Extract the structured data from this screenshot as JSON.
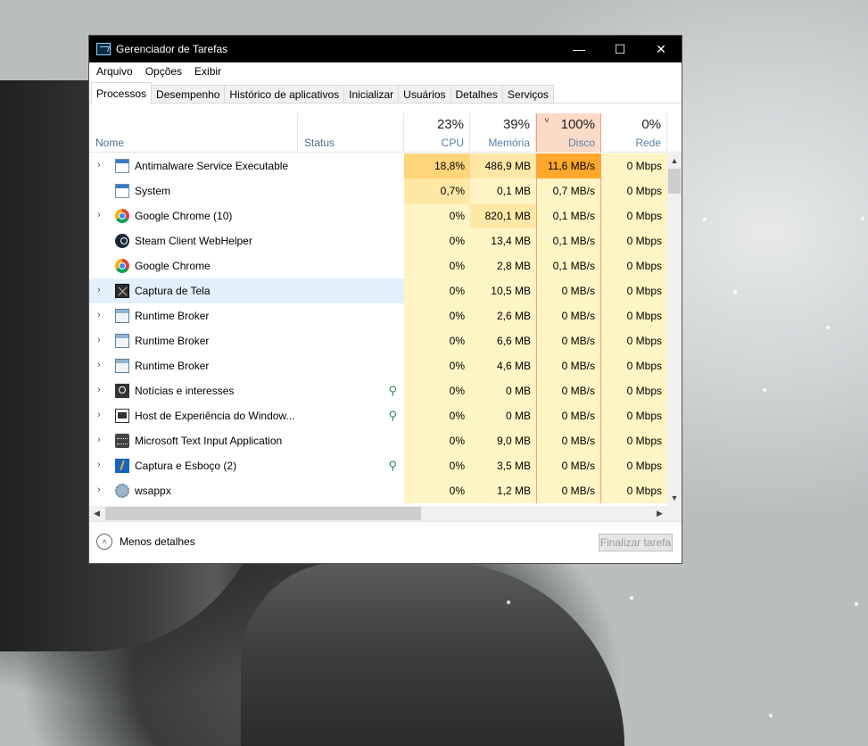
{
  "window": {
    "title": "Gerenciador de Tarefas",
    "controls": {
      "minimize": "—",
      "maximize": "☐",
      "close": "✕"
    }
  },
  "menu": [
    "Arquivo",
    "Opções",
    "Exibir"
  ],
  "tabs": [
    {
      "label": "Processos",
      "active": true
    },
    {
      "label": "Desempenho",
      "active": false
    },
    {
      "label": "Histórico de aplicativos",
      "active": false
    },
    {
      "label": "Inicializar",
      "active": false
    },
    {
      "label": "Usuários",
      "active": false
    },
    {
      "label": "Detalhes",
      "active": false
    },
    {
      "label": "Serviços",
      "active": false
    }
  ],
  "columns": {
    "name": "Nome",
    "status": "Status",
    "cpu": {
      "pct": "23%",
      "label": "CPU"
    },
    "memory": {
      "pct": "39%",
      "label": "Memória"
    },
    "disk": {
      "pct": "100%",
      "label": "Disco",
      "sorted": true
    },
    "network": {
      "pct": "0%",
      "label": "Rede"
    }
  },
  "processes": [
    {
      "name": "Antimalware Service Executable",
      "expandable": true,
      "icon": "window-icon",
      "status": "",
      "cpu": "18,8%",
      "memory": "486,9 MB",
      "disk": "11,6 MB/s",
      "network": "0 Mbps"
    },
    {
      "name": "System",
      "expandable": false,
      "icon": "window-icon",
      "status": "",
      "cpu": "0,7%",
      "memory": "0,1 MB",
      "disk": "0,7 MB/s",
      "network": "0 Mbps"
    },
    {
      "name": "Google Chrome (10)",
      "expandable": true,
      "icon": "chrome-icon",
      "status": "",
      "cpu": "0%",
      "memory": "820,1 MB",
      "disk": "0,1 MB/s",
      "network": "0 Mbps"
    },
    {
      "name": "Steam Client WebHelper",
      "expandable": false,
      "icon": "steam-icon",
      "status": "",
      "cpu": "0%",
      "memory": "13,4 MB",
      "disk": "0,1 MB/s",
      "network": "0 Mbps"
    },
    {
      "name": "Google Chrome",
      "expandable": false,
      "icon": "chrome-icon",
      "status": "",
      "cpu": "0%",
      "memory": "2,8 MB",
      "disk": "0,1 MB/s",
      "network": "0 Mbps"
    },
    {
      "name": "Captura de Tela",
      "expandable": true,
      "icon": "snipping-icon",
      "status": "",
      "cpu": "0%",
      "memory": "10,5 MB",
      "disk": "0 MB/s",
      "network": "0 Mbps",
      "highlight": true
    },
    {
      "name": "Runtime Broker",
      "expandable": true,
      "icon": "broker-icon",
      "status": "",
      "cpu": "0%",
      "memory": "2,6 MB",
      "disk": "0 MB/s",
      "network": "0 Mbps"
    },
    {
      "name": "Runtime Broker",
      "expandable": true,
      "icon": "broker-icon",
      "status": "",
      "cpu": "0%",
      "memory": "6,6 MB",
      "disk": "0 MB/s",
      "network": "0 Mbps"
    },
    {
      "name": "Runtime Broker",
      "expandable": true,
      "icon": "broker-icon",
      "status": "",
      "cpu": "0%",
      "memory": "4,6 MB",
      "disk": "0 MB/s",
      "network": "0 Mbps"
    },
    {
      "name": "Notícias e interesses",
      "expandable": true,
      "icon": "news-icon",
      "status": "leaf",
      "cpu": "0%",
      "memory": "0 MB",
      "disk": "0 MB/s",
      "network": "0 Mbps"
    },
    {
      "name": "Host de Experiência do Window...",
      "expandable": true,
      "icon": "host-icon",
      "status": "leaf",
      "cpu": "0%",
      "memory": "0 MB",
      "disk": "0 MB/s",
      "network": "0 Mbps"
    },
    {
      "name": "Microsoft Text Input Application",
      "expandable": true,
      "icon": "keyboard-icon",
      "status": "",
      "cpu": "0%",
      "memory": "9,0 MB",
      "disk": "0 MB/s",
      "network": "0 Mbps"
    },
    {
      "name": "Captura e Esboço (2)",
      "expandable": true,
      "icon": "sketch-icon",
      "status": "leaf",
      "cpu": "0%",
      "memory": "3,5 MB",
      "disk": "0 MB/s",
      "network": "0 Mbps"
    },
    {
      "name": "wsappx",
      "expandable": true,
      "icon": "gear-icon",
      "status": "",
      "cpu": "0%",
      "memory": "1,2 MB",
      "disk": "0 MB/s",
      "network": "0 Mbps"
    }
  ],
  "footer": {
    "less_details": "Menos detalhes",
    "end_task": "Finalizar tarefa"
  }
}
